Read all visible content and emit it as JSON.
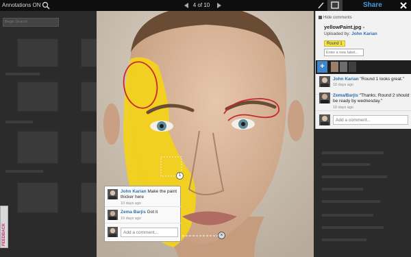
{
  "toolbar": {
    "annotations_label": "Annotations ON",
    "pager_text": "4 of 10",
    "share_label": "Share",
    "icons": [
      "zoom-icon",
      "prev-arrow-icon",
      "next-arrow-icon",
      "pen-icon",
      "box-tool-icon",
      "close-icon"
    ]
  },
  "background_page": {
    "search_placeholder": "Begin Search"
  },
  "panel": {
    "hide_label": "Hide comments",
    "file_name": "yellowPaint.jpg -",
    "uploaded_prefix": "Uploaded by:",
    "uploaded_by": "John Karian",
    "round_tag": "Round 1",
    "new_label_placeholder": "Enter a new label...",
    "comments": [
      {
        "author": "John Karian",
        "text": "\"Round 1 looks great.\"",
        "time": "10 days ago"
      },
      {
        "author": "Zema/Barjis",
        "text": "\"Thanks. Round 2 should be ready by wednesday.\"",
        "time": "10 days ago"
      }
    ],
    "add_comment_placeholder": "Add a comment..."
  },
  "popup": {
    "pin_number": "1",
    "comments": [
      {
        "author": "John Karian",
        "text": "Make the paint thicker here",
        "time": "10 days ago"
      },
      {
        "author": "Zema Barjis",
        "text": "Got it",
        "time": "10 days ago"
      }
    ],
    "add_comment_placeholder": "Add a comment..."
  },
  "side_tab": {
    "label": "FEEDBACK"
  },
  "colors": {
    "accent": "#3c86c9",
    "link": "#2a6eb5",
    "round_tag": "#f4e54b",
    "annotation_stroke": "#c8262e",
    "paint": "#f2d21b"
  }
}
